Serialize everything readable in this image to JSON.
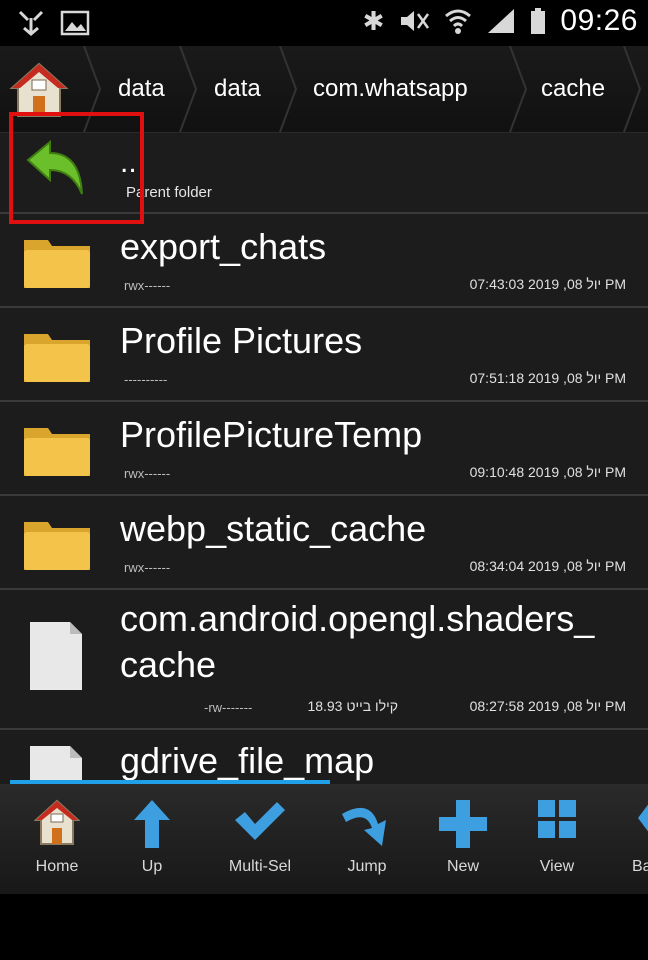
{
  "status_bar": {
    "time": "09:26",
    "icons": [
      "usb-icon",
      "image-icon",
      "bluetooth-icon",
      "mute-icon",
      "wifi-icon",
      "signal-icon",
      "battery-icon"
    ]
  },
  "breadcrumb": {
    "items": [
      "data",
      "data",
      "com.whatsapp",
      "cache"
    ]
  },
  "parent": {
    "dots": "..",
    "label": "Parent folder"
  },
  "files": [
    {
      "name": "export_chats",
      "perm": "rwx------",
      "meta": "יול 08, 2019 07:43:03 PM",
      "type": "folder"
    },
    {
      "name": "Profile Pictures",
      "perm": "----------",
      "meta": "יול 08, 2019 07:51:18 PM",
      "type": "folder"
    },
    {
      "name": "ProfilePictureTemp",
      "perm": "rwx------",
      "meta": "יול 08, 2019 09:10:48 PM",
      "type": "folder"
    },
    {
      "name": "webp_static_cache",
      "perm": "rwx------",
      "meta": "יול 08, 2019 08:34:04 PM",
      "type": "folder"
    },
    {
      "name_line1": "com.android.opengl.shaders_",
      "name_line2": "cache",
      "perm": "-rw-------",
      "size": "18.93 קילו בייט",
      "meta": "יול 08, 2019 08:27:58 PM",
      "type": "file"
    },
    {
      "name": "gdrive_file_map",
      "type": "file"
    }
  ],
  "toolbar": {
    "home": "Home",
    "up": "Up",
    "multi_sel": "Multi-Sel",
    "jump": "Jump",
    "new": "New",
    "view": "View",
    "back": "Ba"
  },
  "colors": {
    "highlight": "#e01010",
    "accent": "#1fa0e8",
    "folder": "#f4c44a",
    "up_arrow": "#3d9ee0",
    "back_arrow": "#6bbf2a"
  }
}
